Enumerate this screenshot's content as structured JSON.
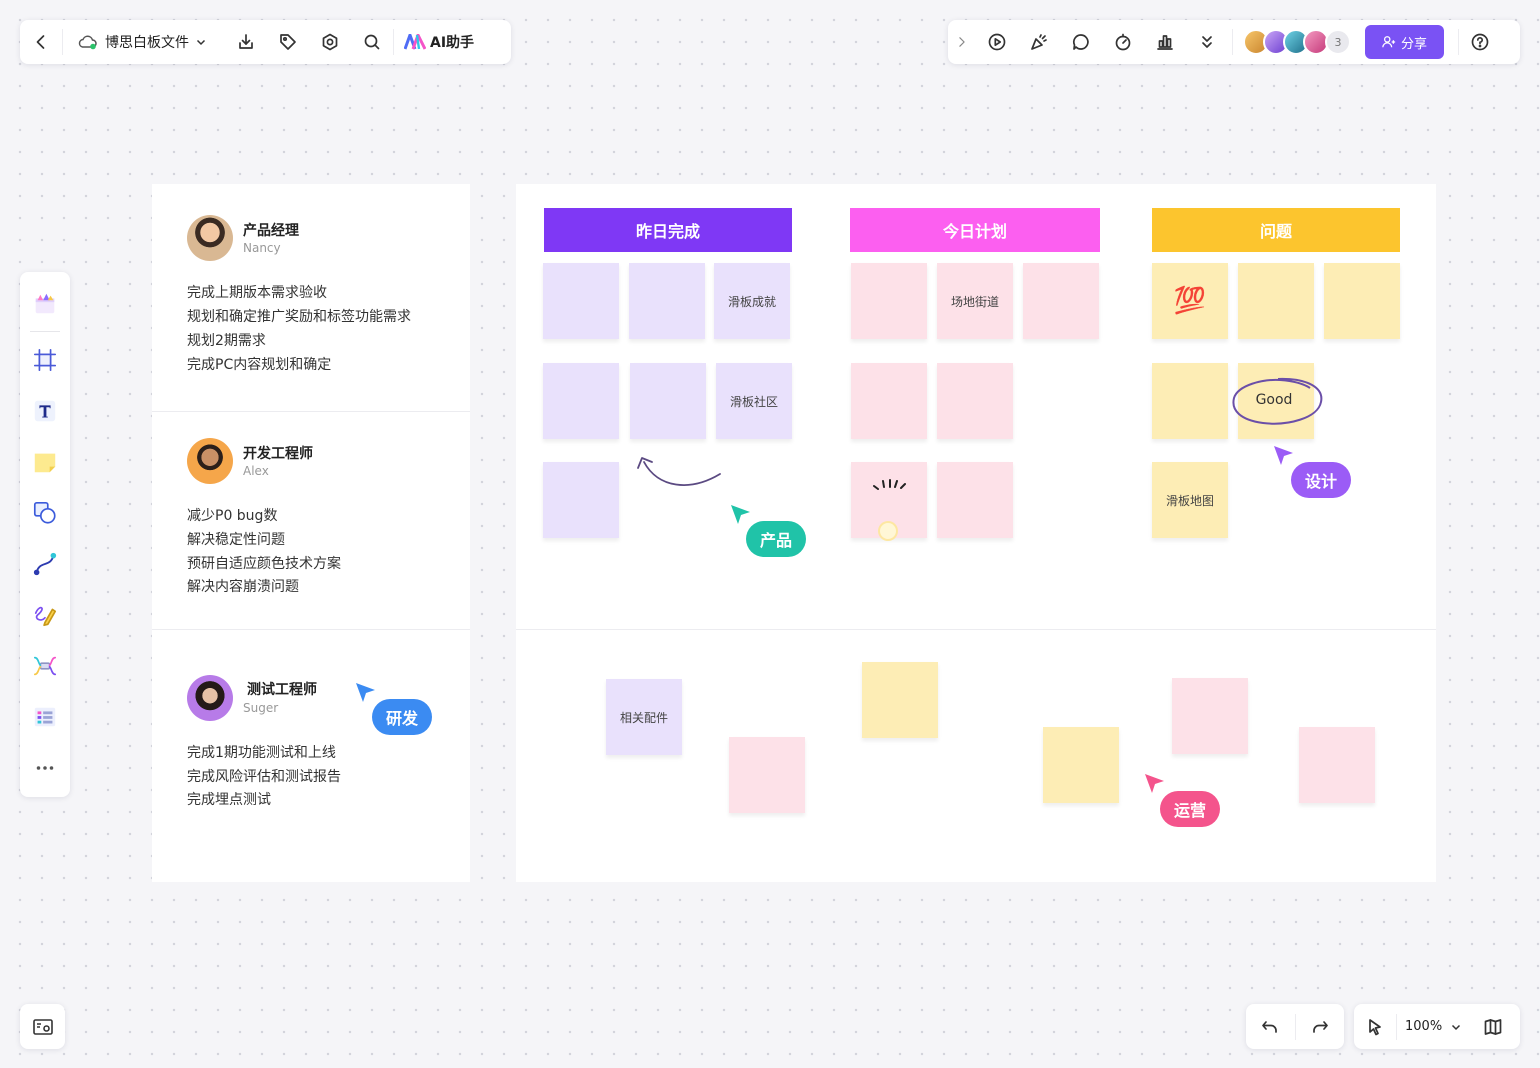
{
  "toolbar": {
    "file_title": "博思白板文件",
    "ai_label": "AI助手",
    "share_label": "分享",
    "collaborator_count": "3"
  },
  "zoom": {
    "value": "100%"
  },
  "people": [
    {
      "role": "产品经理",
      "name": "Nancy",
      "tasks": [
        "完成上期版本需求验收",
        "规划和确定推广奖励和标签功能需求",
        "规划2期需求",
        "完成PC内容规划和确定"
      ]
    },
    {
      "role": "开发工程师",
      "name": "Alex",
      "tasks": [
        "减少P0 bug数",
        "解决稳定性问题",
        "预研自适应颜色技术方案",
        "解决内容崩溃问题"
      ]
    },
    {
      "role": "测试工程师",
      "name": "Suger",
      "tasks": [
        "完成1期功能测试和上线",
        "完成风险评估和测试报告",
        "完成埋点测试"
      ]
    }
  ],
  "columns": [
    {
      "title": "昨日完成",
      "color": "#7f38f5"
    },
    {
      "title": "今日计划",
      "color": "#fc5ff0"
    },
    {
      "title": "问题",
      "color": "#fcc52e"
    }
  ],
  "notes": {
    "skate_done": "滑板成就",
    "skate_community": "滑板社区",
    "venue_street": "场地街道",
    "good": "Good",
    "skate_map": "滑板地图",
    "related_parts": "相关配件",
    "emoji_100": "💯"
  },
  "cursors": {
    "product": {
      "label": "产品",
      "color": "#20c3a8"
    },
    "design": {
      "label": "设计",
      "color": "#9b5cf6"
    },
    "dev": {
      "label": "研发",
      "color": "#3b8bf2"
    },
    "ops": {
      "label": "运营",
      "color": "#f4548c"
    }
  }
}
